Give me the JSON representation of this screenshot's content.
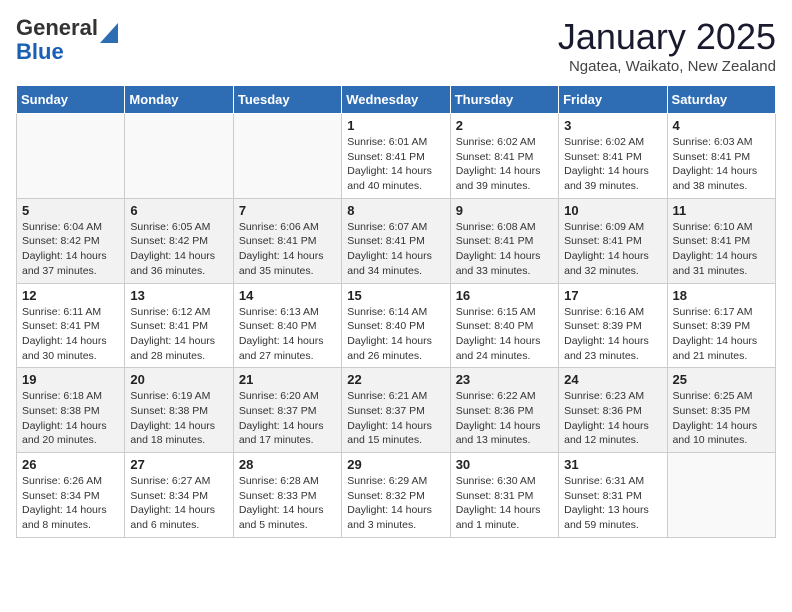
{
  "logo": {
    "general": "General",
    "blue": "Blue"
  },
  "header": {
    "month": "January 2025",
    "location": "Ngatea, Waikato, New Zealand"
  },
  "weekdays": [
    "Sunday",
    "Monday",
    "Tuesday",
    "Wednesday",
    "Thursday",
    "Friday",
    "Saturday"
  ],
  "weeks": [
    [
      {
        "day": "",
        "sunrise": "",
        "sunset": "",
        "daylight": ""
      },
      {
        "day": "",
        "sunrise": "",
        "sunset": "",
        "daylight": ""
      },
      {
        "day": "",
        "sunrise": "",
        "sunset": "",
        "daylight": ""
      },
      {
        "day": "1",
        "sunrise": "Sunrise: 6:01 AM",
        "sunset": "Sunset: 8:41 PM",
        "daylight": "Daylight: 14 hours and 40 minutes."
      },
      {
        "day": "2",
        "sunrise": "Sunrise: 6:02 AM",
        "sunset": "Sunset: 8:41 PM",
        "daylight": "Daylight: 14 hours and 39 minutes."
      },
      {
        "day": "3",
        "sunrise": "Sunrise: 6:02 AM",
        "sunset": "Sunset: 8:41 PM",
        "daylight": "Daylight: 14 hours and 39 minutes."
      },
      {
        "day": "4",
        "sunrise": "Sunrise: 6:03 AM",
        "sunset": "Sunset: 8:41 PM",
        "daylight": "Daylight: 14 hours and 38 minutes."
      }
    ],
    [
      {
        "day": "5",
        "sunrise": "Sunrise: 6:04 AM",
        "sunset": "Sunset: 8:42 PM",
        "daylight": "Daylight: 14 hours and 37 minutes."
      },
      {
        "day": "6",
        "sunrise": "Sunrise: 6:05 AM",
        "sunset": "Sunset: 8:42 PM",
        "daylight": "Daylight: 14 hours and 36 minutes."
      },
      {
        "day": "7",
        "sunrise": "Sunrise: 6:06 AM",
        "sunset": "Sunset: 8:41 PM",
        "daylight": "Daylight: 14 hours and 35 minutes."
      },
      {
        "day": "8",
        "sunrise": "Sunrise: 6:07 AM",
        "sunset": "Sunset: 8:41 PM",
        "daylight": "Daylight: 14 hours and 34 minutes."
      },
      {
        "day": "9",
        "sunrise": "Sunrise: 6:08 AM",
        "sunset": "Sunset: 8:41 PM",
        "daylight": "Daylight: 14 hours and 33 minutes."
      },
      {
        "day": "10",
        "sunrise": "Sunrise: 6:09 AM",
        "sunset": "Sunset: 8:41 PM",
        "daylight": "Daylight: 14 hours and 32 minutes."
      },
      {
        "day": "11",
        "sunrise": "Sunrise: 6:10 AM",
        "sunset": "Sunset: 8:41 PM",
        "daylight": "Daylight: 14 hours and 31 minutes."
      }
    ],
    [
      {
        "day": "12",
        "sunrise": "Sunrise: 6:11 AM",
        "sunset": "Sunset: 8:41 PM",
        "daylight": "Daylight: 14 hours and 30 minutes."
      },
      {
        "day": "13",
        "sunrise": "Sunrise: 6:12 AM",
        "sunset": "Sunset: 8:41 PM",
        "daylight": "Daylight: 14 hours and 28 minutes."
      },
      {
        "day": "14",
        "sunrise": "Sunrise: 6:13 AM",
        "sunset": "Sunset: 8:40 PM",
        "daylight": "Daylight: 14 hours and 27 minutes."
      },
      {
        "day": "15",
        "sunrise": "Sunrise: 6:14 AM",
        "sunset": "Sunset: 8:40 PM",
        "daylight": "Daylight: 14 hours and 26 minutes."
      },
      {
        "day": "16",
        "sunrise": "Sunrise: 6:15 AM",
        "sunset": "Sunset: 8:40 PM",
        "daylight": "Daylight: 14 hours and 24 minutes."
      },
      {
        "day": "17",
        "sunrise": "Sunrise: 6:16 AM",
        "sunset": "Sunset: 8:39 PM",
        "daylight": "Daylight: 14 hours and 23 minutes."
      },
      {
        "day": "18",
        "sunrise": "Sunrise: 6:17 AM",
        "sunset": "Sunset: 8:39 PM",
        "daylight": "Daylight: 14 hours and 21 minutes."
      }
    ],
    [
      {
        "day": "19",
        "sunrise": "Sunrise: 6:18 AM",
        "sunset": "Sunset: 8:38 PM",
        "daylight": "Daylight: 14 hours and 20 minutes."
      },
      {
        "day": "20",
        "sunrise": "Sunrise: 6:19 AM",
        "sunset": "Sunset: 8:38 PM",
        "daylight": "Daylight: 14 hours and 18 minutes."
      },
      {
        "day": "21",
        "sunrise": "Sunrise: 6:20 AM",
        "sunset": "Sunset: 8:37 PM",
        "daylight": "Daylight: 14 hours and 17 minutes."
      },
      {
        "day": "22",
        "sunrise": "Sunrise: 6:21 AM",
        "sunset": "Sunset: 8:37 PM",
        "daylight": "Daylight: 14 hours and 15 minutes."
      },
      {
        "day": "23",
        "sunrise": "Sunrise: 6:22 AM",
        "sunset": "Sunset: 8:36 PM",
        "daylight": "Daylight: 14 hours and 13 minutes."
      },
      {
        "day": "24",
        "sunrise": "Sunrise: 6:23 AM",
        "sunset": "Sunset: 8:36 PM",
        "daylight": "Daylight: 14 hours and 12 minutes."
      },
      {
        "day": "25",
        "sunrise": "Sunrise: 6:25 AM",
        "sunset": "Sunset: 8:35 PM",
        "daylight": "Daylight: 14 hours and 10 minutes."
      }
    ],
    [
      {
        "day": "26",
        "sunrise": "Sunrise: 6:26 AM",
        "sunset": "Sunset: 8:34 PM",
        "daylight": "Daylight: 14 hours and 8 minutes."
      },
      {
        "day": "27",
        "sunrise": "Sunrise: 6:27 AM",
        "sunset": "Sunset: 8:34 PM",
        "daylight": "Daylight: 14 hours and 6 minutes."
      },
      {
        "day": "28",
        "sunrise": "Sunrise: 6:28 AM",
        "sunset": "Sunset: 8:33 PM",
        "daylight": "Daylight: 14 hours and 5 minutes."
      },
      {
        "day": "29",
        "sunrise": "Sunrise: 6:29 AM",
        "sunset": "Sunset: 8:32 PM",
        "daylight": "Daylight: 14 hours and 3 minutes."
      },
      {
        "day": "30",
        "sunrise": "Sunrise: 6:30 AM",
        "sunset": "Sunset: 8:31 PM",
        "daylight": "Daylight: 14 hours and 1 minute."
      },
      {
        "day": "31",
        "sunrise": "Sunrise: 6:31 AM",
        "sunset": "Sunset: 8:31 PM",
        "daylight": "Daylight: 13 hours and 59 minutes."
      },
      {
        "day": "",
        "sunrise": "",
        "sunset": "",
        "daylight": ""
      }
    ]
  ]
}
